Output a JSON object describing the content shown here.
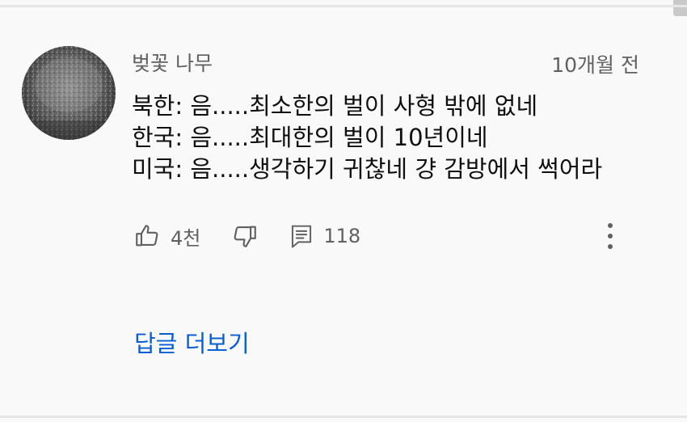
{
  "comment": {
    "author": "벚꽃 나무",
    "timestamp": "10개월 전",
    "lines": [
      "북한: 음.....최소한의 벌이 사형 밖에 없네",
      "한국: 음.....최대한의 벌이 10년이네",
      "미국: 음.....생각하기 귀찮네 걍 감방에서 썩어라"
    ]
  },
  "actions": {
    "like_count": "4천",
    "reply_count": "118",
    "like_icon": "thumbs-up-icon",
    "dislike_icon": "thumbs-down-icon",
    "reply_icon": "comment-icon",
    "more_icon": "more-vertical-icon"
  },
  "replies": {
    "label": "답글 더보기"
  },
  "colors": {
    "background": "#f9f9f9",
    "text": "#0f0f0f",
    "secondary_text": "#606060",
    "link": "#065fd4"
  }
}
